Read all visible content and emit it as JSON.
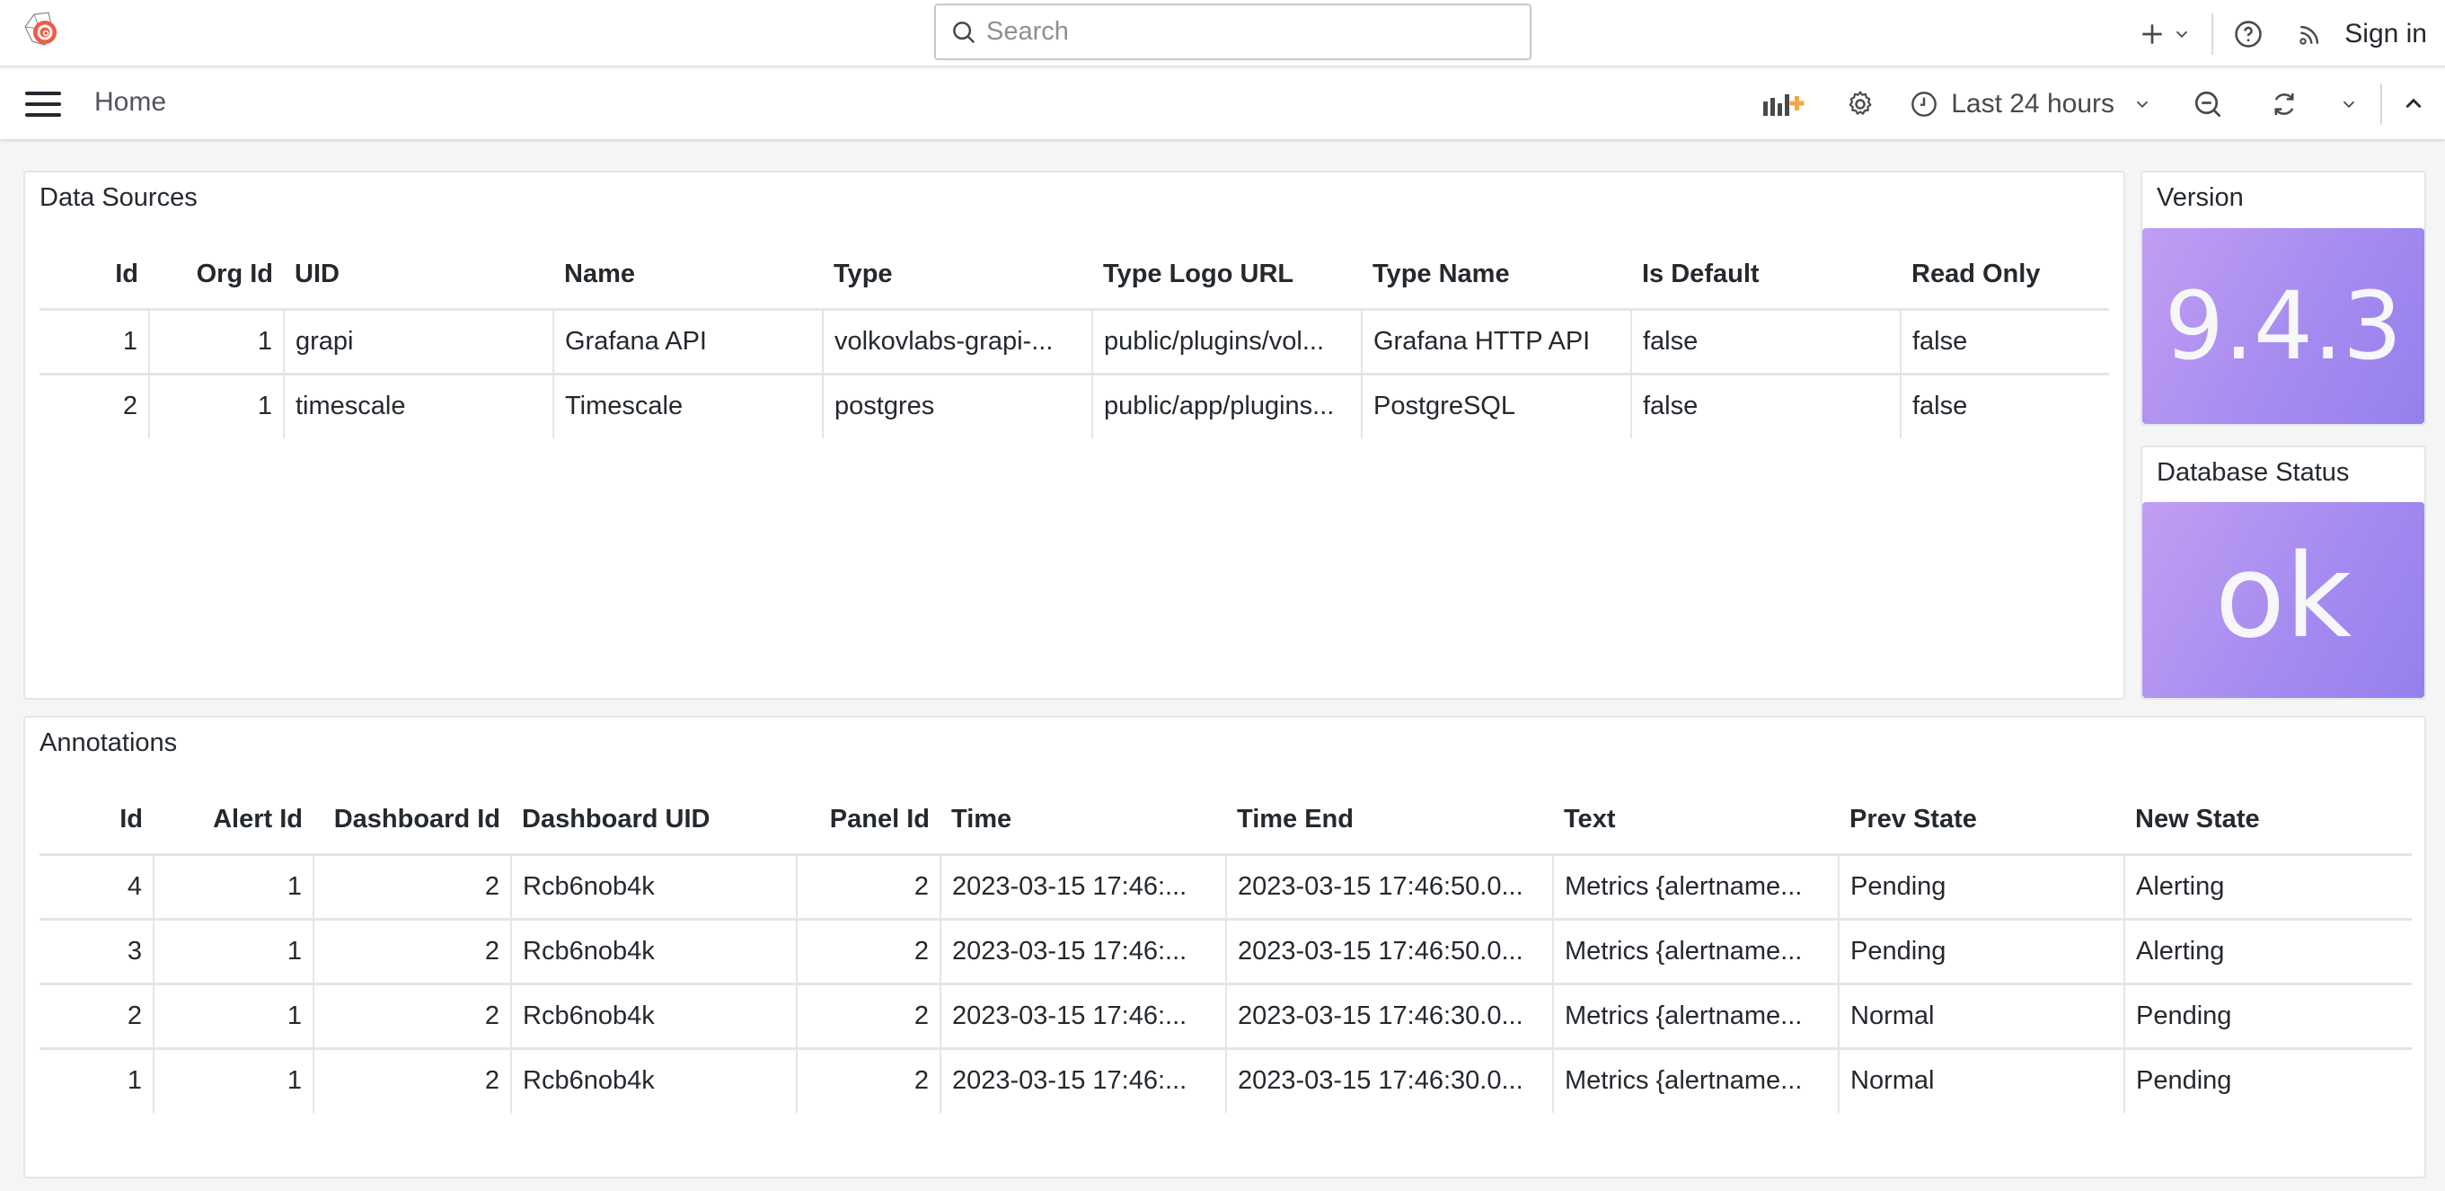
{
  "topbar": {
    "search_placeholder": "Search",
    "sign_in_label": "Sign in",
    "icons": [
      "grafana-logo-icon",
      "search-icon",
      "plus-icon",
      "chevron-down-icon",
      "help-icon",
      "rss-icon"
    ]
  },
  "navbar": {
    "breadcrumb": "Home",
    "time_range_label": "Last 24 hours",
    "icons": [
      "menu-icon",
      "add-panel-icon",
      "gear-icon",
      "clock-icon",
      "chevron-down-icon",
      "zoom-out-icon",
      "refresh-icon",
      "chevron-down-icon",
      "chevron-up-icon"
    ],
    "accent_color": "#f5a742"
  },
  "data_sources": {
    "title": "Data Sources",
    "columns": [
      "Id",
      "Org Id",
      "UID",
      "Name",
      "Type",
      "Type Logo URL",
      "Type Name",
      "Is Default",
      "Read Only"
    ],
    "rows": [
      [
        "1",
        "1",
        "grapi",
        "Grafana API",
        "volkovlabs-grapi-...",
        "public/plugins/vol...",
        "Grafana HTTP API",
        "false",
        "false"
      ],
      [
        "2",
        "1",
        "timescale",
        "Timescale",
        "postgres",
        "public/app/plugins...",
        "PostgreSQL",
        "false",
        "false"
      ]
    ]
  },
  "version": {
    "title": "Version",
    "value": "9.4.3"
  },
  "database_status": {
    "title": "Database Status",
    "value": "ok"
  },
  "stat_colors": {
    "start": "#c09ef2",
    "end": "#9580ec"
  },
  "annotations": {
    "title": "Annotations",
    "columns": [
      "Id",
      "Alert Id",
      "Dashboard Id",
      "Dashboard UID",
      "Panel Id",
      "Time",
      "Time End",
      "Text",
      "Prev State",
      "New State"
    ],
    "rows": [
      [
        "4",
        "1",
        "2",
        "Rcb6nob4k",
        "2",
        "2023-03-15 17:46:...",
        "2023-03-15 17:46:50.0...",
        "Metrics {alertname...",
        "Pending",
        "Alerting"
      ],
      [
        "3",
        "1",
        "2",
        "Rcb6nob4k",
        "2",
        "2023-03-15 17:46:...",
        "2023-03-15 17:46:50.0...",
        "Metrics {alertname...",
        "Pending",
        "Alerting"
      ],
      [
        "2",
        "1",
        "2",
        "Rcb6nob4k",
        "2",
        "2023-03-15 17:46:...",
        "2023-03-15 17:46:30.0...",
        "Metrics {alertname...",
        "Normal",
        "Pending"
      ],
      [
        "1",
        "1",
        "2",
        "Rcb6nob4k",
        "2",
        "2023-03-15 17:46:...",
        "2023-03-15 17:46:30.0...",
        "Metrics {alertname...",
        "Normal",
        "Pending"
      ]
    ]
  }
}
